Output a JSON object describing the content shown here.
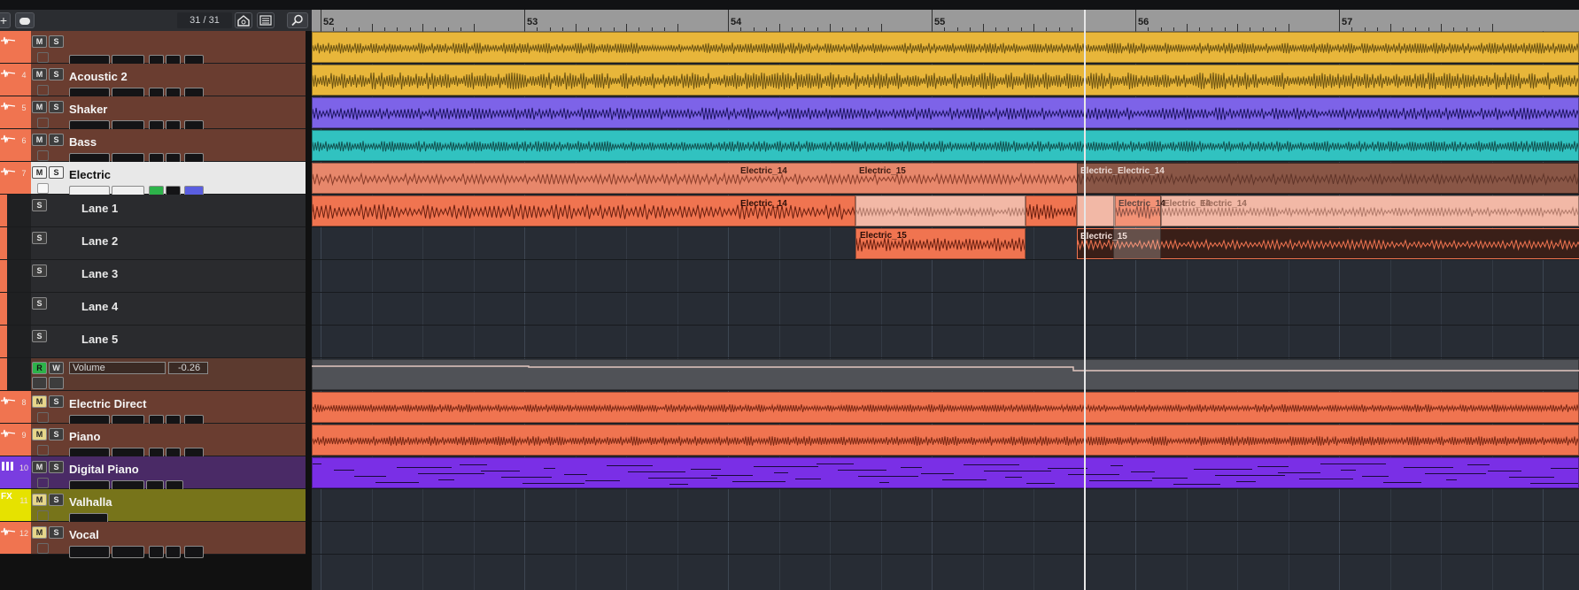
{
  "toolbar": {
    "add_track": "+",
    "track_count": "31 / 31",
    "cloud_icon": "cloud-icon",
    "search_icon": "search-icon"
  },
  "tracks": [
    {
      "num": "",
      "name": "",
      "color": "#b55c40",
      "type": "audio",
      "mute": "M",
      "solo": "S"
    },
    {
      "num": "4",
      "name": "Acoustic 2",
      "color": "#f07450",
      "type": "audio",
      "mute": "M",
      "solo": "S"
    },
    {
      "num": "5",
      "name": "Shaker",
      "color": "#f07450",
      "type": "audio",
      "mute": "M",
      "solo": "S"
    },
    {
      "num": "6",
      "name": "Bass",
      "color": "#f07450",
      "type": "audio",
      "mute": "M",
      "solo": "S"
    },
    {
      "num": "7",
      "name": "Electric",
      "color": "#f07450",
      "type": "audio",
      "mute": "M",
      "solo": "S",
      "selected": true
    },
    {
      "lane": "Lane 1",
      "solo": "S"
    },
    {
      "lane": "Lane 2",
      "solo": "S"
    },
    {
      "lane": "Lane 3",
      "solo": "S"
    },
    {
      "lane": "Lane 4",
      "solo": "S"
    },
    {
      "lane": "Lane 5",
      "solo": "S"
    },
    {
      "automation": true,
      "read": "R",
      "write": "W",
      "param": "Volume",
      "value": "-0.26"
    },
    {
      "num": "8",
      "name": "Electric Direct",
      "color": "#f07450",
      "type": "audio",
      "mute": "M",
      "solo": "S",
      "muted": true
    },
    {
      "num": "9",
      "name": "Piano",
      "color": "#f07450",
      "type": "audio",
      "mute": "M",
      "solo": "S",
      "muted": true
    },
    {
      "num": "10",
      "name": "Digital Piano",
      "color": "#7a3de0",
      "type": "instrument",
      "mute": "M",
      "solo": "S"
    },
    {
      "num": "11",
      "name": "Valhalla",
      "color": "#e6e200",
      "type": "fx",
      "mute": "M",
      "solo": "S",
      "muted": true,
      "fx_label": "FX"
    },
    {
      "num": "12",
      "name": "Vocal",
      "color": "#f07450",
      "type": "audio",
      "mute": "M",
      "solo": "S",
      "muted": true
    }
  ],
  "ruler": {
    "bars": [
      "52",
      "53",
      "54",
      "55",
      "56",
      "57"
    ]
  },
  "regions": {
    "electric_labels": [
      "Electric_14",
      "Electric_15",
      "Electric_",
      "Electric_14"
    ],
    "lane1_labels": [
      "Electric_14",
      "Electric_14",
      "Electric_14",
      "Electric_14"
    ],
    "lane2_labels": [
      "Electric_15",
      "Electric_15"
    ]
  },
  "colors": {
    "gold": "#e8b63a",
    "violet": "#7d63e8",
    "teal": "#31c2c0",
    "salmon": "#e7876b",
    "orange": "#f07450",
    "purple": "#7a2fe6",
    "olive": "#6f6a1c"
  }
}
